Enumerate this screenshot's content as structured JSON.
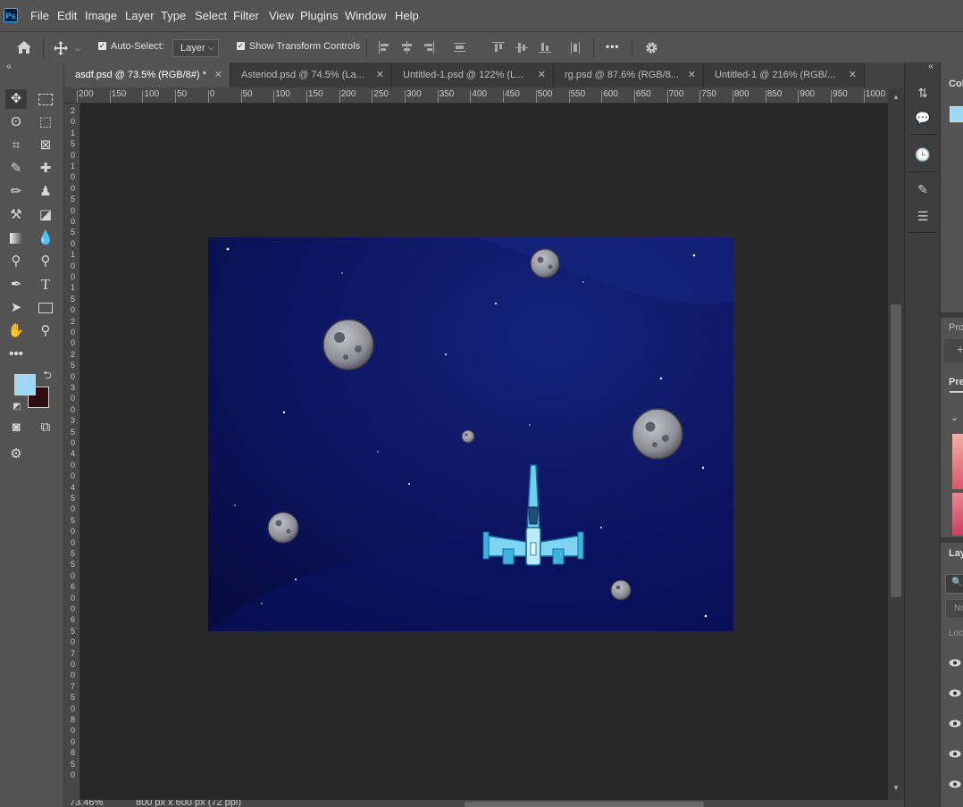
{
  "app": {
    "logo_text": "Ps"
  },
  "menu": {
    "items": [
      "File",
      "Edit",
      "Image",
      "Layer",
      "Type",
      "Select",
      "Filter",
      "View",
      "Plugins",
      "Window",
      "Help"
    ]
  },
  "options_bar": {
    "auto_select_label": "Auto-Select:",
    "auto_select_checked": true,
    "auto_select_target": "Layer",
    "show_transform_label": "Show Transform Controls",
    "show_transform_checked": true,
    "more_label": "•••"
  },
  "tabs": [
    {
      "label": "asdf.psd @ 73.5% (RGB/8#) *",
      "active": true
    },
    {
      "label": "Asteriod.psd @ 74.5% (La...",
      "active": false
    },
    {
      "label": "Untitled-1.psd @ 122% (L...",
      "active": false
    },
    {
      "label": "rg.psd @ 87.6% (RGB/8...",
      "active": false
    },
    {
      "label": "Untitled-1 @ 216% (RGB/...",
      "active": false
    }
  ],
  "ruler_top": [
    "200",
    "150",
    "100",
    "50",
    "0",
    "50",
    "100",
    "150",
    "200",
    "250",
    "300",
    "350",
    "400",
    "450",
    "500",
    "550",
    "600",
    "650",
    "700",
    "750",
    "800",
    "850",
    "900",
    "950",
    "1000"
  ],
  "ruler_left": [
    "2",
    "0",
    "1",
    "5",
    "0",
    "1",
    "0",
    "0",
    "5",
    "0",
    "0",
    "5",
    "0",
    "1",
    "0",
    "0",
    "1",
    "5",
    "0",
    "2",
    "0",
    "0",
    "2",
    "5",
    "0",
    "3",
    "0",
    "0",
    "3",
    "5",
    "0",
    "4",
    "0",
    "0",
    "4",
    "5",
    "0",
    "5",
    "0",
    "0",
    "5",
    "5",
    "0",
    "6",
    "0",
    "0",
    "6",
    "5",
    "0",
    "7",
    "0",
    "0",
    "7",
    "5",
    "0",
    "8",
    "0",
    "0",
    "8",
    "5",
    "0"
  ],
  "status": {
    "zoom": "73.46%",
    "doc_info": "800 px x 600 px (72 ppi)"
  },
  "colors": {
    "foreground": "#9ed8f5",
    "background": "#2e0d12",
    "accent": "#31a8ff"
  },
  "right_panels": {
    "color_title": "Col",
    "properties_title": "Pro",
    "presets_title": "Pre",
    "layers_title": "Lay",
    "filter_placeholder": "No",
    "lock_label": "Lock"
  }
}
